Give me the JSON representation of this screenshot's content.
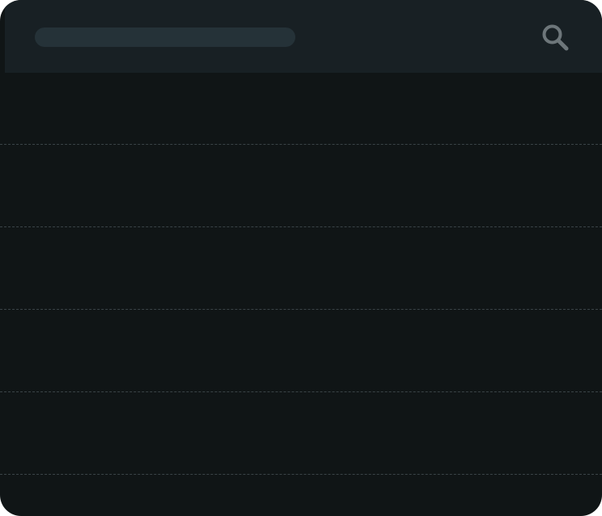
{
  "header": {
    "search": {
      "value": "",
      "icon": "search-icon"
    }
  },
  "list": {
    "rows": [
      "",
      "",
      "",
      "",
      ""
    ]
  },
  "colors": {
    "window_bg": "#101516",
    "header_bg": "#182024",
    "search_pill": "#253238",
    "icon": "#6d767a",
    "divider": "#3a4347"
  }
}
